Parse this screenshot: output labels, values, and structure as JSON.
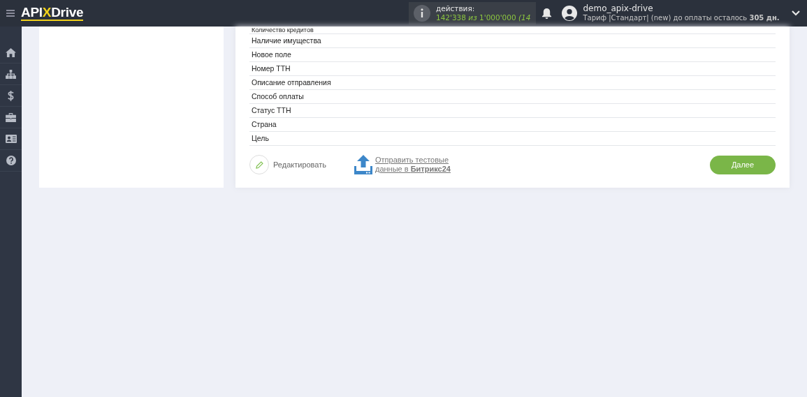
{
  "header": {
    "logo": {
      "left": "API",
      "mark": "X",
      "right": "Drive"
    },
    "actions": {
      "label": "действия:",
      "used": "142'338",
      "of": "из 1'000'000",
      "extra": "(14"
    },
    "user": {
      "name": "demo_apix-drive",
      "plan": "Тариф |Стандарт| (new) до оплаты осталось **305 дн.**"
    }
  },
  "sidebar": {
    "items": [
      {
        "selected": false
      },
      {
        "selected": false
      },
      {
        "selected": false
      },
      {
        "selected": false
      },
      {
        "selected": false
      },
      {
        "selected": false
      }
    ]
  },
  "fields": [
    "Количество кредитов",
    "Наличие имущества",
    "Новое поле",
    "Номер ТТН",
    "Описание отправления",
    "Способ оплаты",
    "Статус ТТН",
    "Страна",
    "Цель"
  ],
  "actions": {
    "edit": "Редактировать",
    "send": "Отправить тестовые данные в **Битрикс24**",
    "next": "Далее"
  }
}
